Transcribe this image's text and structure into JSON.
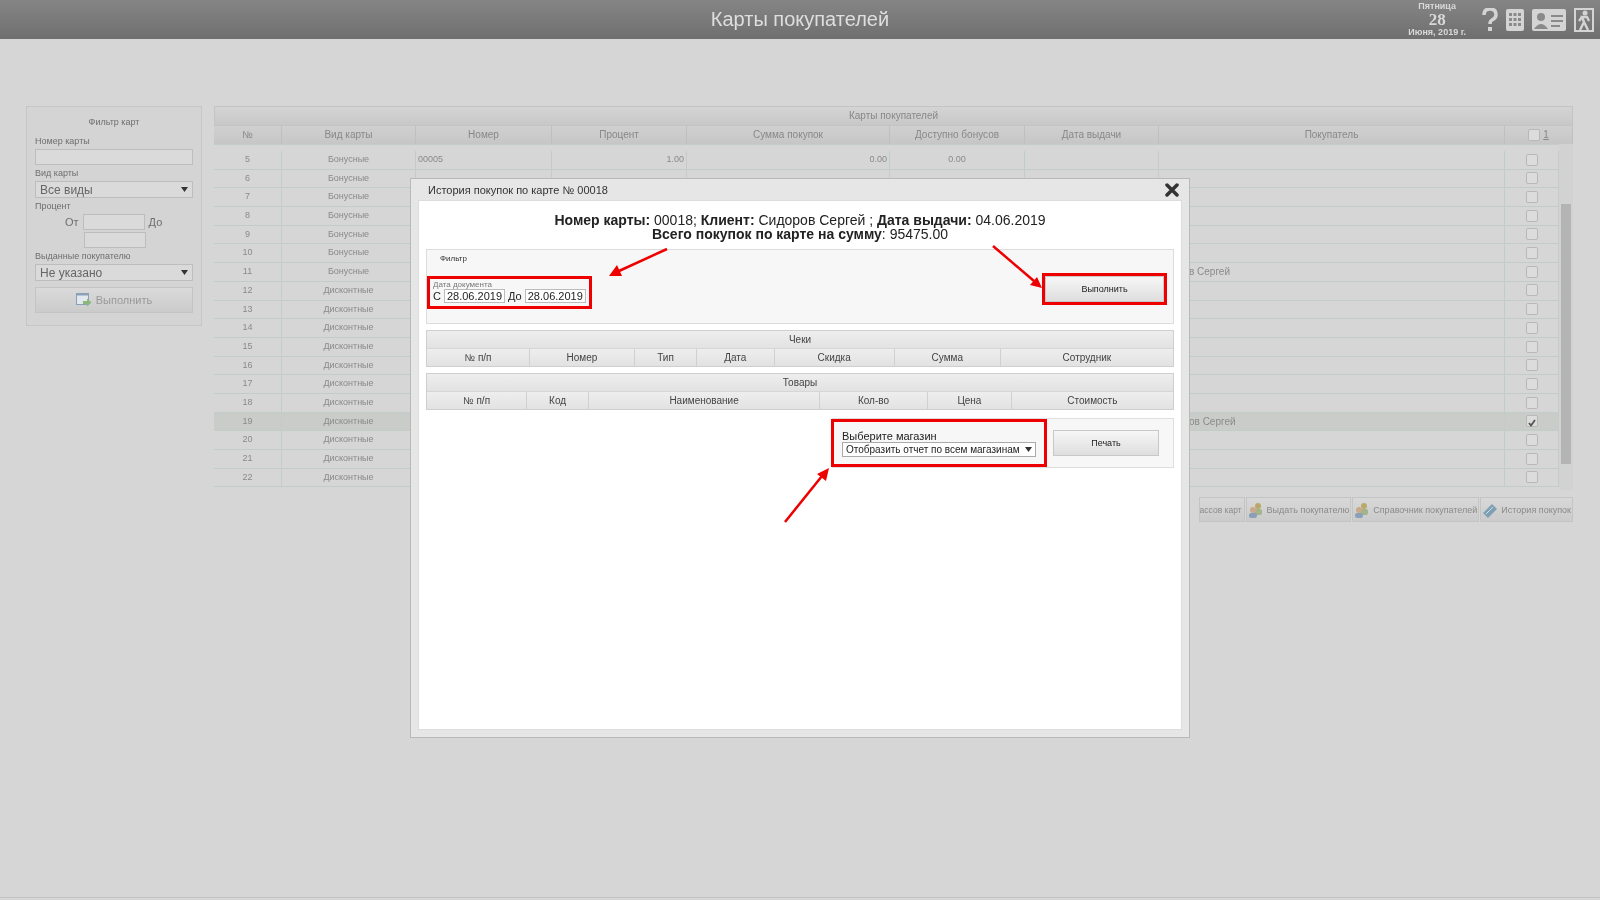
{
  "header": {
    "title": "Карты покупателей",
    "weekday": "Пятница",
    "day": "28",
    "month_year": "Июня, 2019 г."
  },
  "filter_panel": {
    "title": "Фильтр карт",
    "card_number_label": "Номер карты",
    "card_type_label": "Вид карты",
    "card_type_value": "Все виды",
    "percent_label": "Процент",
    "from_label": "От",
    "to_label": "До",
    "issued_label": "Выданные покупателю",
    "issued_value": "Не указано",
    "run_button": "Выполнить"
  },
  "cards_table": {
    "title": "Карты покупателей",
    "columns": [
      "№",
      "Вид карты",
      "Номер",
      "Процент",
      "Сумма покупок",
      "Доступно бонусов",
      "Дата выдачи",
      "Покупатель"
    ],
    "select_all_checked": false,
    "page_link": "1",
    "rows": [
      {
        "n": "5",
        "type": "Бонусные",
        "number": "00005",
        "percent": "1.00",
        "total": "0.00",
        "bonus": "0.00",
        "selected": false,
        "checked": false
      },
      {
        "n": "6",
        "type": "Бонусные",
        "selected": false,
        "checked": false
      },
      {
        "n": "7",
        "type": "Бонусные",
        "selected": false,
        "checked": false
      },
      {
        "n": "8",
        "type": "Бонусные",
        "selected": false,
        "checked": false
      },
      {
        "n": "9",
        "type": "Бонусные",
        "selected": false,
        "checked": false
      },
      {
        "n": "10",
        "type": "Бонусные",
        "selected": false,
        "checked": false
      },
      {
        "n": "11",
        "type": "Бонусные",
        "customer": "в Сергей",
        "selected": false,
        "checked": false
      },
      {
        "n": "12",
        "type": "Дисконтные",
        "selected": false,
        "checked": false
      },
      {
        "n": "13",
        "type": "Дисконтные",
        "selected": false,
        "checked": false
      },
      {
        "n": "14",
        "type": "Дисконтные",
        "selected": false,
        "checked": false
      },
      {
        "n": "15",
        "type": "Дисконтные",
        "selected": false,
        "checked": false
      },
      {
        "n": "16",
        "type": "Дисконтные",
        "selected": false,
        "checked": false
      },
      {
        "n": "17",
        "type": "Дисконтные",
        "selected": false,
        "checked": false
      },
      {
        "n": "18",
        "type": "Дисконтные",
        "selected": false,
        "checked": false
      },
      {
        "n": "19",
        "type": "Дисконтные",
        "customer": "ов Сергей",
        "selected": true,
        "checked": true
      },
      {
        "n": "20",
        "type": "Дисконтные",
        "selected": false,
        "checked": false
      },
      {
        "n": "21",
        "type": "Дисконтные",
        "selected": false,
        "checked": false
      },
      {
        "n": "22",
        "type": "Дисконтные",
        "selected": false,
        "checked": false
      }
    ]
  },
  "toolbar": [
    {
      "label": "ассов карт",
      "kind": "plain"
    },
    {
      "label": "Выдать покупателю",
      "kind": "people"
    },
    {
      "label": "Справочник покупателей",
      "kind": "people"
    },
    {
      "label": "История покупок",
      "kind": "ticket"
    }
  ],
  "modal": {
    "title": "История покупок по карте № 00018",
    "summary": [
      "**Номер карты:** 00018; **Клиент:** Сидоров Сергей ; **Дата выдачи:** 04.06.2019",
      "**Всего покупок по карте на сумму**: 95475.00"
    ],
    "filter": {
      "legend": "Фильтр",
      "date_label": "Дата документа",
      "from_label": "С",
      "from_value": "28.06.2019",
      "to_label": "До",
      "to_value": "28.06.2019",
      "run_button": "Выполнить"
    },
    "checks_table": {
      "title": "Чеки",
      "columns": [
        "№ п/п",
        "Номер",
        "Тип",
        "Дата",
        "Скидка",
        "Сумма",
        "Сотрудник"
      ]
    },
    "goods_table": {
      "title": "Товары",
      "columns": [
        "№ п/п",
        "Код",
        "Наименование",
        "Кол-во",
        "Цена",
        "Стоимость"
      ]
    },
    "store": {
      "label": "Выберите магазин",
      "value": "Отобразить отчет по всем магазинам",
      "print_button": "Печать"
    }
  }
}
